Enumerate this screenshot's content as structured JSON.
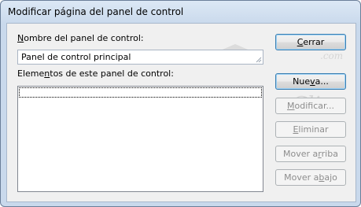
{
  "window": {
    "title": "Modificar página del panel de control"
  },
  "form": {
    "name_label_pre": "",
    "name_label_accel": "N",
    "name_label_post": "ombre del panel de control:",
    "name_value": "Panel de control principal",
    "elements_label_pre": "Eleme",
    "elements_label_accel": "n",
    "elements_label_post": "tos de este panel de control:",
    "elements_items": []
  },
  "buttons": {
    "close": {
      "pre": "",
      "accel": "C",
      "post": "errar",
      "enabled": true
    },
    "new": {
      "pre": "Nue",
      "accel": "v",
      "post": "a...",
      "enabled": true
    },
    "edit": {
      "pre": "",
      "accel": "M",
      "post": "odificar...",
      "enabled": false
    },
    "delete": {
      "pre": "",
      "accel": "E",
      "post": "liminar",
      "enabled": false
    },
    "move_up": {
      "pre": "Mover a",
      "accel": "r",
      "post": "riba",
      "enabled": false
    },
    "move_down": {
      "pre": "Mover a",
      "accel": "b",
      "post": "ajo",
      "enabled": false
    }
  },
  "watermark": {
    "brand_top": "aula",
    "brand_bottom": "Clic",
    "domain": ".com"
  },
  "colors": {
    "titlebar": "#c9d9ec",
    "client": "#f0f0f0",
    "disabled_text": "#8d8d8d",
    "default_button_border": "#3c7fb1"
  }
}
